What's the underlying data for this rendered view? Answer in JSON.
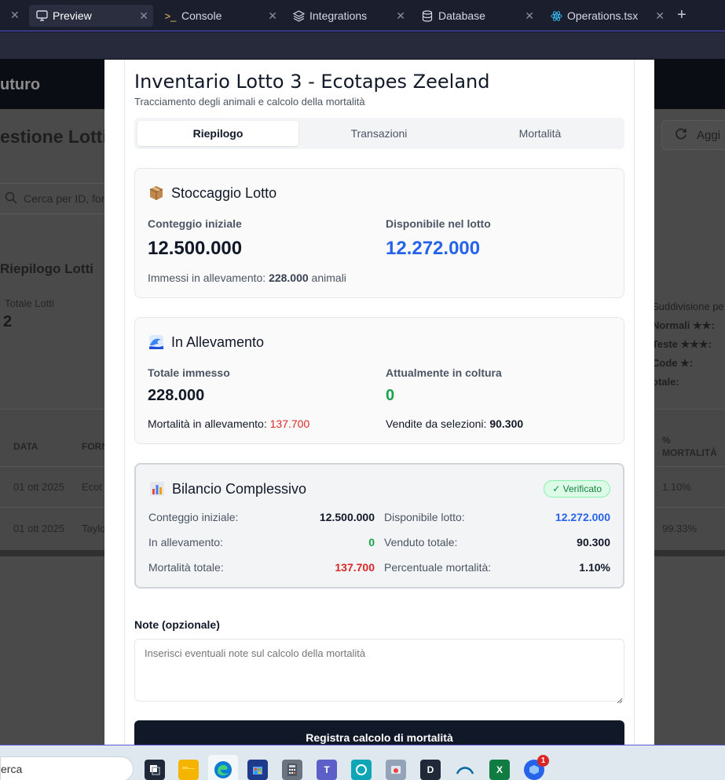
{
  "tabs": [
    {
      "label": "Preview",
      "icon": "monitor-icon",
      "active": true
    },
    {
      "label": "Console",
      "icon": "terminal-icon",
      "active": false
    },
    {
      "label": "Integrations",
      "icon": "layers-icon",
      "active": false
    },
    {
      "label": "Database",
      "icon": "database-icon",
      "active": false
    },
    {
      "label": "Operations.tsx",
      "icon": "react-icon",
      "active": false
    }
  ],
  "background": {
    "brand": "uturo",
    "title": "estione Lotti",
    "refresh": "Aggi",
    "search_placeholder": "Cerca per ID, for",
    "summary_title": "Riepilogo Lotti",
    "total_label": "Totale Lotti",
    "total_value": "2",
    "breakdown_title": "Suddivisione pe",
    "breakdown": [
      "Normali ★★:",
      "Teste ★★★:",
      "Code ★:",
      "otale:"
    ],
    "table": {
      "headers": [
        "DATA",
        "FORN",
        "%",
        "MORTALITÀ"
      ],
      "rows": [
        {
          "date": "01 ott 2025",
          "supplier": "Ecot",
          "pct": "1.10%"
        },
        {
          "date": "01 ott 2025",
          "supplier": "Taylo",
          "pct": "99.33%"
        }
      ]
    }
  },
  "modal": {
    "title": "Inventario Lotto 3 - Ecotapes Zeeland",
    "subtitle": "Tracciamento degli animali e calcolo della mortalità",
    "tabs": [
      "Riepilogo",
      "Transazioni",
      "Mortalità"
    ],
    "stock": {
      "emoji": "package-icon",
      "title": "Stoccaggio Lotto",
      "initial_label": "Conteggio iniziale",
      "initial_value": "12.500.000",
      "available_label": "Disponibile nel lotto",
      "available_value": "12.272.000",
      "note_prefix": "Immessi in allevamento: ",
      "note_value": "228.000",
      "note_suffix": " animali"
    },
    "farming": {
      "emoji": "wave-icon",
      "title": "In Allevamento",
      "total_label": "Totale immesso",
      "total_value": "228.000",
      "current_label": "Attualmente in coltura",
      "current_value": "0",
      "mortality_label": "Mortalità in allevamento: ",
      "mortality_value": "137.700",
      "sales_label": "Vendite da selezioni: ",
      "sales_value": "90.300"
    },
    "balance": {
      "emoji": "chart-icon",
      "title": "Bilancio Complessivo",
      "badge": "✓ Verificato",
      "left": [
        {
          "label": "Conteggio iniziale:",
          "value": "12.500.000",
          "color": "#111827"
        },
        {
          "label": "In allevamento:",
          "value": "0",
          "color": "#16a34a"
        },
        {
          "label": "Mortalità totale:",
          "value": "137.700",
          "color": "#dc2626"
        }
      ],
      "right": [
        {
          "label": "Disponibile lotto:",
          "value": "12.272.000",
          "color": "#2563eb"
        },
        {
          "label": "Venduto totale:",
          "value": "90.300",
          "color": "#111827"
        },
        {
          "label": "Percentuale mortalità:",
          "value": "1.10%",
          "color": "#111827"
        }
      ]
    },
    "notes_label": "Note (opzionale)",
    "notes_placeholder": "Inserisci eventuali note sul calcolo della mortalità",
    "submit": "Registra calcolo di mortalità"
  },
  "taskbar": {
    "search_text": "erca",
    "notification_count": "1"
  }
}
